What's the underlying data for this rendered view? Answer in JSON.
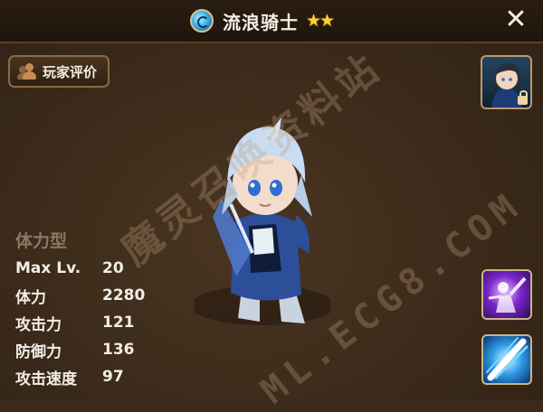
{
  "header": {
    "monster_name": "流浪骑士",
    "element_icon": "water-element-icon",
    "stars": "★★",
    "star_count": 2,
    "close_icon": "close-icon",
    "close_glyph": "✕"
  },
  "review_button": {
    "label": "玩家评价",
    "icon": "people-icon"
  },
  "side_buttons": {
    "portrait": "awakened-portrait-icon",
    "skills": [
      "skill-1-icon",
      "skill-2-icon"
    ]
  },
  "stats": {
    "type": "体力型",
    "rows": [
      {
        "label": "Max Lv.",
        "value": "20"
      },
      {
        "label": "体力",
        "value": "2280"
      },
      {
        "label": "攻击力",
        "value": "121"
      },
      {
        "label": "防御力",
        "value": "136"
      },
      {
        "label": "攻击速度",
        "value": "97"
      }
    ]
  },
  "watermark": {
    "line1": "魔灵召唤资料站",
    "line2": "ML.ECG8.COM"
  },
  "colors": {
    "background": "#3b2a1a",
    "star": "#ffd23a",
    "stat_type": "#8b7a63"
  }
}
